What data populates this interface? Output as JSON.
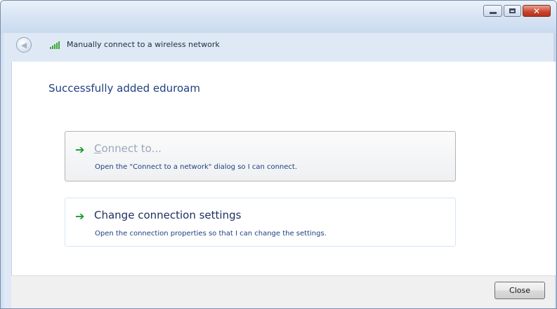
{
  "window": {
    "title": "Manually connect to a wireless network",
    "controls": {
      "minimize_icon": "minimize-icon",
      "maximize_icon": "maximize-icon",
      "close_icon": "close-icon",
      "close_glyph": "✕"
    },
    "back_icon": "back-arrow-icon",
    "back_glyph": "◀",
    "network_icon": "wireless-signal-icon"
  },
  "main": {
    "heading": "Successfully added eduroam",
    "options": [
      {
        "title": "Connect to...",
        "description": "Open the \"Connect to a network\" dialog so I can connect.",
        "icon": "green-arrow-icon",
        "arrow_glyph": "➔"
      },
      {
        "title": "Change connection settings",
        "description": "Open the connection properties so that I can change the settings.",
        "icon": "green-arrow-icon",
        "arrow_glyph": "➔"
      }
    ]
  },
  "footer": {
    "close_label": "Close"
  },
  "colors": {
    "accent": "#1f3f82",
    "arrow": "#1d9a2e",
    "disabled_text": "#9aa7bc"
  }
}
